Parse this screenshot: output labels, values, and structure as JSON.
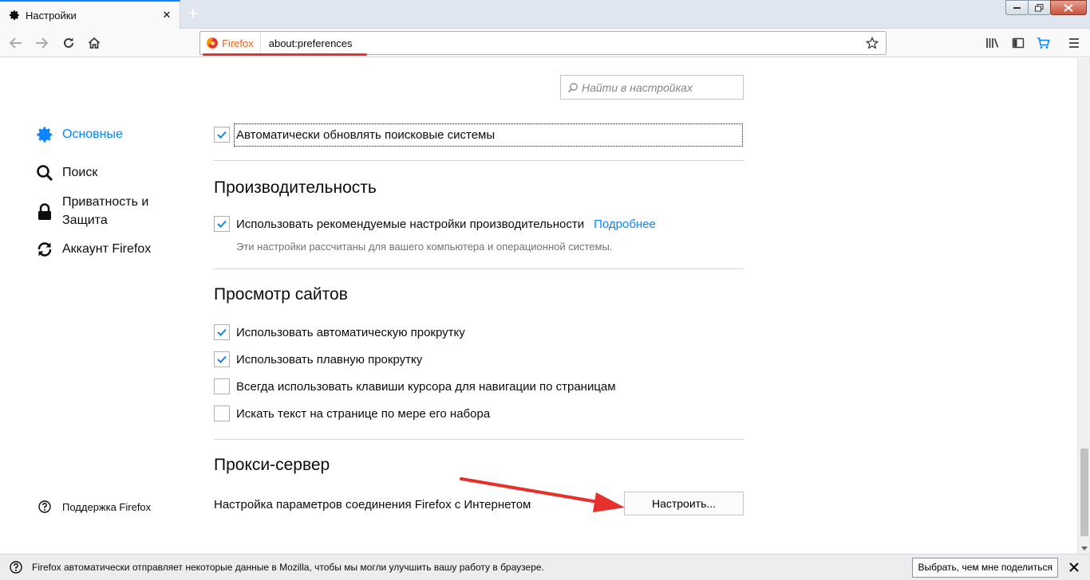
{
  "tab": {
    "title": "Настройки",
    "close": "✕",
    "new_tab": "+"
  },
  "urlbar": {
    "identity_label": "Firefox",
    "url": "about:preferences"
  },
  "search": {
    "placeholder": "Найти в настройках"
  },
  "sidebar": {
    "items": [
      {
        "label": "Основные",
        "icon": "gear-icon",
        "active": true
      },
      {
        "label": "Поиск",
        "icon": "search-icon",
        "active": false
      },
      {
        "label": "Приватность и Защита",
        "icon": "lock-icon",
        "active": false
      },
      {
        "label": "Аккаунт Firefox",
        "icon": "sync-icon",
        "active": false
      }
    ],
    "support": "Поддержка Firefox"
  },
  "general": {
    "auto_update_search": {
      "label": "Автоматически обновлять поисковые системы",
      "checked": true
    }
  },
  "performance": {
    "title": "Производительность",
    "recommended": {
      "label": "Использовать рекомендуемые настройки производительности",
      "checked": true
    },
    "learn_more": "Подробнее",
    "note": "Эти настройки рассчитаны для вашего компьютера и операционной системы."
  },
  "browsing": {
    "title": "Просмотр сайтов",
    "options": [
      {
        "label": "Использовать автоматическую прокрутку",
        "checked": true
      },
      {
        "label": "Использовать плавную прокрутку",
        "checked": true
      },
      {
        "label": "Всегда использовать клавиши курсора для навигации по страницам",
        "checked": false
      },
      {
        "label": "Искать текст на странице по мере его набора",
        "checked": false
      }
    ]
  },
  "proxy": {
    "title": "Прокси-сервер",
    "description": "Настройка параметров соединения Firefox с Интернетом",
    "button": "Настроить..."
  },
  "notification": {
    "text": "Firefox автоматически отправляет некоторые данные в Mozilla, чтобы мы могли улучшить вашу работу в браузере.",
    "button": "Выбрать, чем мне поделиться"
  },
  "colors": {
    "accent": "#0a84ff",
    "annotation": "#e5302b",
    "firefox_orange": "#e8641c"
  }
}
